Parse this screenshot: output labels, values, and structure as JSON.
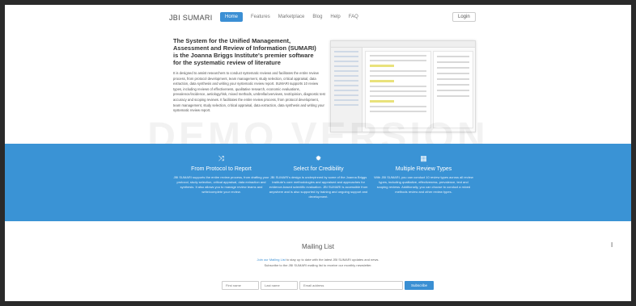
{
  "nav": {
    "brand": "JBI SUMARI",
    "links": [
      {
        "label": "Home",
        "active": true
      },
      {
        "label": "Features"
      },
      {
        "label": "Marketplace"
      },
      {
        "label": "Blog"
      },
      {
        "label": "Help"
      },
      {
        "label": "FAQ"
      }
    ],
    "login": "Login"
  },
  "hero": {
    "title": "The System for the Unified Management, Assessment and Review of Information (SUMARI) is the Joanna Briggs Institute's premier software for the systematic review of literature",
    "body": "It is designed to assist researchers to conduct systematic reviews and facilitates the entire review process, from protocol development, team management, study selection, critical appraisal, data extraction, data synthesis and writing your systematic review report. SUMARI supports 10 review types, including reviews of effectiveness, qualitative research, economic evaluations, prevalence/incidence, aetiology/risk, mixed methods, umbrella/overviews, text/opinion, diagnostic test accuracy and scoping reviews. It facilitates the entire review process, from protocol development, team management, study selection, critical appraisal, data extraction, data synthesis and writing your systematic review report."
  },
  "watermark": "DEMO VERSION",
  "features": [
    {
      "icon": "shuffle-icon",
      "title": "From Protocol to Report",
      "text": "JBI SUMARI supports the entire review process, from drafting your protocol, study selection, critical appraisal, data extraction and synthesis. It also allows you to manage review teams and write/complete your review."
    },
    {
      "icon": "gear-icon",
      "title": "Select for Credibility",
      "text": "JBI SUMARI's design is underpinned by some of the Joanna Briggs Institute's core methodologies and appraised and approaches for evidence-based scientific evaluation. JBI SUMARI is accessible from anywhere and is also supported by training and ongoing support and development."
    },
    {
      "icon": "grid-icon",
      "title": "Multiple Review Types",
      "text": "With JBI SUMARI, you can conduct 10 review types across all review types, including qualitative, effectiveness, prevalence, text and scoping reviews. Additionally, you can choose to conduct a mixed methods review and other review types."
    }
  ],
  "mailing": {
    "title": "Mailing List",
    "line1": "Join our Mailing List to stay up to date with the latest JBI SUMARI updates and news.",
    "line1_link": "Join our Mailing List",
    "line2": "Subscribe to the JBI SUMARI mailing list to receive our monthly newsletter.",
    "first_name_placeholder": "First name",
    "last_name_placeholder": "Last name",
    "email_placeholder": "Email address",
    "subscribe": "Subscribe"
  }
}
